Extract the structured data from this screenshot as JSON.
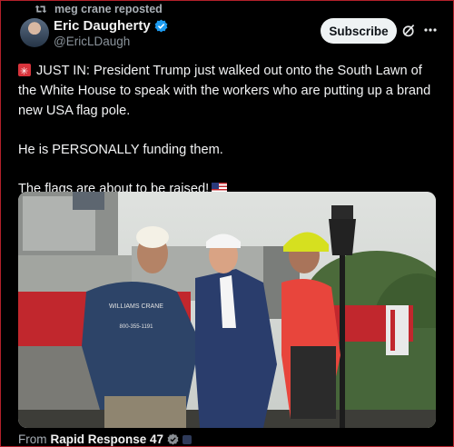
{
  "repost": {
    "label": "meg crane reposted"
  },
  "author": {
    "name": "Eric Daugherty",
    "handle": "@EricLDaugh"
  },
  "subscribe_label": "Subscribe",
  "tweet": {
    "line1": "JUST IN: President Trump just walked out onto the South Lawn of the White House to speak with the workers who are putting up a brand new USA flag pole.",
    "line2": "He is PERSONALLY funding them.",
    "line3": "The flags are about to be raised!"
  },
  "media": {
    "shirt_text": "WILLIAMS CRANE",
    "shirt_phone": "800-355-1191"
  },
  "from": {
    "prefix": "From",
    "source": "Rapid Response 47"
  },
  "colors": {
    "accent": "#1d9bf0",
    "background": "#000000",
    "gold": "#e2b719"
  }
}
